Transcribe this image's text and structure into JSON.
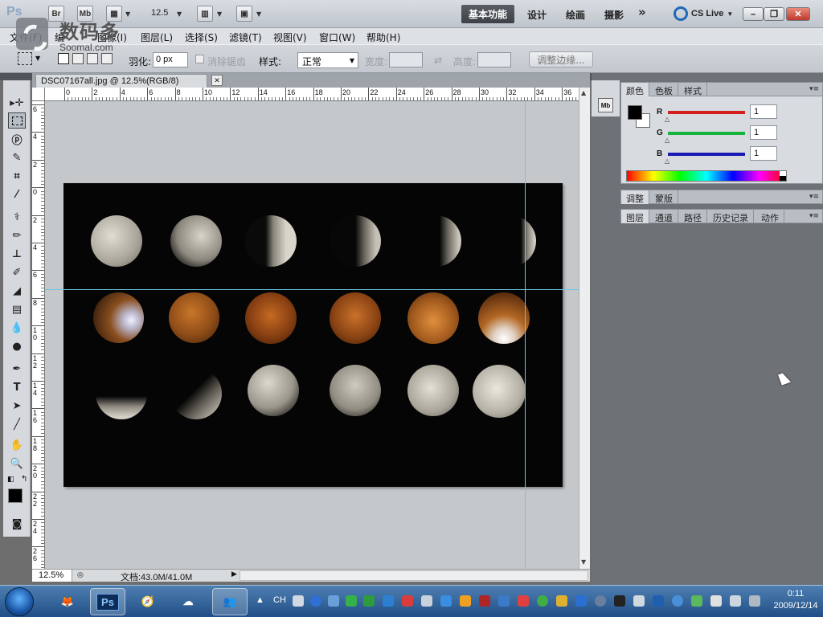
{
  "app": {
    "logo": "Ps",
    "bridge_btn": "Br",
    "minibridge_btn": "Mb",
    "zoom_select": "12.5",
    "workspaces": {
      "active": "基本功能",
      "items": [
        "设计",
        "绘画",
        "摄影"
      ],
      "more": "»"
    },
    "cs_live": "CS Live"
  },
  "watermark": {
    "cn": "数码多",
    "en": "Soomal.com"
  },
  "menu": [
    "文件(F)",
    "编",
    "图像(I)",
    "图层(L)",
    "选择(S)",
    "滤镜(T)",
    "视图(V)",
    "窗口(W)",
    "帮助(H)"
  ],
  "options": {
    "feather_label": "羽化:",
    "feather_value": "0 px",
    "antialias_label": "消除锯齿",
    "style_label": "样式:",
    "style_value": "正常",
    "width_label": "宽度:",
    "height_label": "高度:",
    "refine_edge": "调整边缘..."
  },
  "document": {
    "tab_title": "DSC07167all.jpg @ 12.5%(RGB/8)",
    "close": "✕",
    "ruler_h": [
      "0",
      "2",
      "4",
      "6",
      "8",
      "10",
      "12",
      "14",
      "16",
      "18",
      "20",
      "22",
      "24",
      "26",
      "28",
      "30",
      "32",
      "34",
      "36"
    ],
    "ruler_v": [
      "6",
      "4",
      "2",
      "0",
      "2",
      "4",
      "6",
      "8",
      "1\n0",
      "1\n2",
      "1\n4",
      "1\n6",
      "1\n8",
      "2\n0",
      "2\n2",
      "2\n4",
      "2\n6"
    ]
  },
  "status": {
    "zoom": "12.5%",
    "doc_info": "文档:43.0M/41.0M"
  },
  "color_panel": {
    "tabs": [
      "颜色",
      "色板",
      "样式"
    ],
    "channels": [
      {
        "label": "R",
        "value": "1",
        "color": "#d4201a"
      },
      {
        "label": "G",
        "value": "1",
        "color": "#15b43b"
      },
      {
        "label": "B",
        "value": "1",
        "color": "#1a1ab4"
      }
    ]
  },
  "adjust_panel": {
    "tabs": [
      "调整",
      "蒙版"
    ]
  },
  "layers_panel": {
    "tabs": [
      "图层",
      "通道",
      "路径",
      "历史记录",
      "动作"
    ]
  },
  "taskbar": {
    "ps_label": "Ps",
    "lang": "CH",
    "clock_time": "0:11",
    "clock_date": "2009/12/14"
  }
}
